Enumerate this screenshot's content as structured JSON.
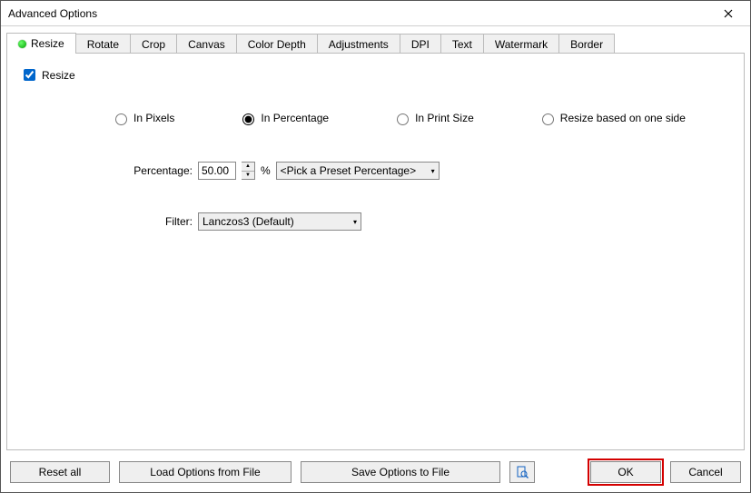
{
  "window": {
    "title": "Advanced Options"
  },
  "tabs": [
    {
      "label": "Resize",
      "active": true
    },
    {
      "label": "Rotate"
    },
    {
      "label": "Crop"
    },
    {
      "label": "Canvas"
    },
    {
      "label": "Color Depth"
    },
    {
      "label": "Adjustments"
    },
    {
      "label": "DPI"
    },
    {
      "label": "Text"
    },
    {
      "label": "Watermark"
    },
    {
      "label": "Border"
    }
  ],
  "resize": {
    "checkbox_label": "Resize",
    "checked": true,
    "radios": {
      "pixels": "In Pixels",
      "percentage": "In Percentage",
      "print": "In Print Size",
      "oneside": "Resize based on one side",
      "selected": "percentage"
    },
    "percentage_label": "Percentage:",
    "percentage_value": "50.00",
    "percent_sign": "%",
    "preset_placeholder": "<Pick a Preset Percentage>",
    "filter_label": "Filter:",
    "filter_value": "Lanczos3 (Default)"
  },
  "buttons": {
    "reset": "Reset all",
    "load": "Load Options from File",
    "save": "Save Options to File",
    "ok": "OK",
    "cancel": "Cancel"
  }
}
